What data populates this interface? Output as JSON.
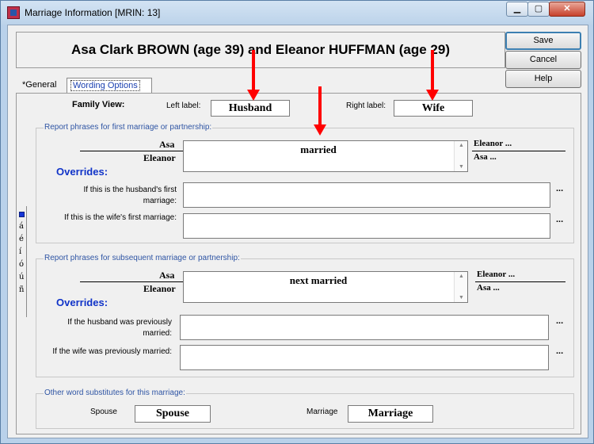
{
  "window": {
    "title": "Marriage Information   [MRIN: 13]",
    "min_label": "▁",
    "max_label": "▢",
    "close_label": "✕"
  },
  "header": {
    "text": "Asa Clark BROWN (age 39) and Eleanor HUFFMAN (age 29)"
  },
  "buttons": {
    "save": "Save",
    "cancel": "Cancel",
    "help": "Help"
  },
  "tabs": {
    "general": "*General",
    "wording": "Wording Options"
  },
  "family_view": {
    "label": "Family View:",
    "left_label": "Left label:",
    "left_value": "Husband",
    "right_label": "Right label:",
    "right_value": "Wife"
  },
  "first_marriage": {
    "legend": "Report phrases for first marriage or partnership:",
    "left_top": "Asa",
    "left_bottom": "Eleanor",
    "phrase": "married",
    "right_top": "Eleanor ...",
    "right_bottom": "Asa ...",
    "overrides": "Overrides:",
    "husband_first": "If this is the husband's first marriage:",
    "wife_first": "If this is the wife's first marriage:",
    "ellipsis": "..."
  },
  "subsequent_marriage": {
    "legend": "Report phrases for subsequent marriage or partnership:",
    "left_top": "Asa",
    "left_bottom": "Eleanor",
    "phrase": "next married",
    "right_top": "Eleanor ...",
    "right_bottom": "Asa ...",
    "overrides": "Overrides:",
    "husband_prev": "If the husband was previously married:",
    "wife_prev": "If the wife was previously married:",
    "ellipsis": "..."
  },
  "other_substitutes": {
    "legend": "Other word substitutes for this marriage:",
    "spouse_label": "Spouse",
    "spouse_value": "Spouse",
    "marriage_label": "Marriage",
    "marriage_value": "Marriage"
  },
  "char_bar": {
    "chars": [
      "á",
      "é",
      "í",
      "ó",
      "ú",
      "ñ"
    ]
  },
  "colors": {
    "legend": "#2f55a4",
    "overrides": "#1033c8",
    "arrows": "#ff0000"
  }
}
